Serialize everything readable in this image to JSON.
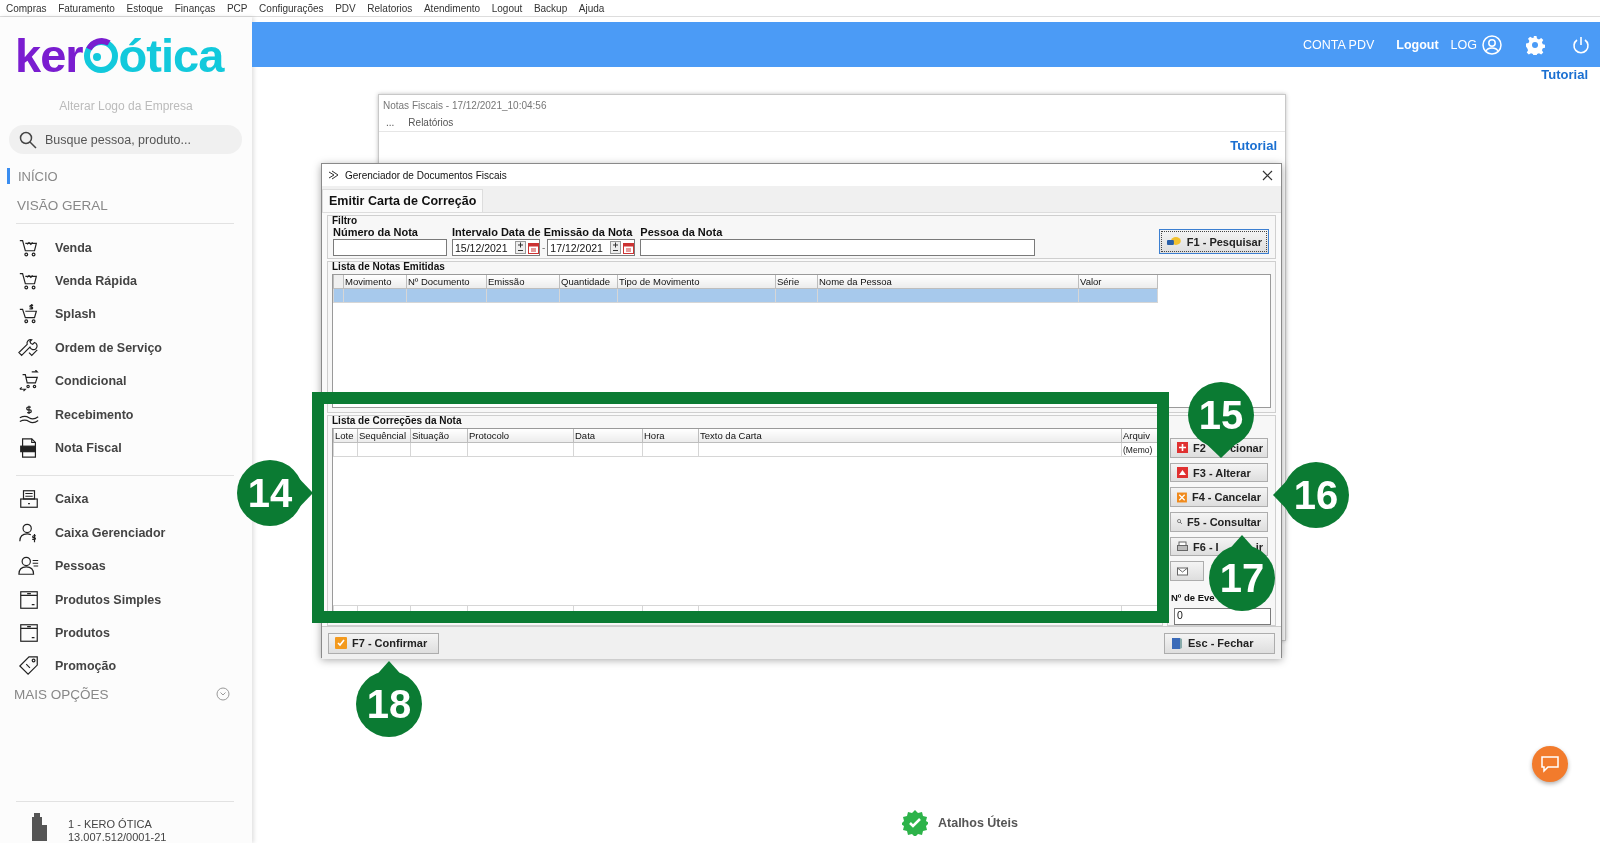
{
  "top_menu": [
    "Compras",
    "Faturamento",
    "Estoque",
    "Finanças",
    "PCP",
    "Configurações",
    "PDV",
    "Relatorios",
    "Atendimento",
    "Logout",
    "Backup",
    "Ajuda"
  ],
  "sidebar": {
    "logo": {
      "left": "ker",
      "right": "ótica"
    },
    "change_logo": "Alterar Logo da Empresa",
    "search": {
      "placeholder": "Busque pessoa, produto..."
    },
    "nav": [
      {
        "label": "INÍCIO",
        "selected": true
      },
      {
        "label": "VISÃO GERAL",
        "selected": false
      }
    ],
    "menu_groups": [
      [
        {
          "label": "Venda",
          "kind": "cart"
        },
        {
          "label": "Venda Rápida",
          "kind": "cart"
        },
        {
          "label": "Splash",
          "kind": "cart-dollar"
        },
        {
          "label": "Ordem de Serviço",
          "kind": "wrench"
        },
        {
          "label": "Condicional",
          "kind": "cart-arrows"
        },
        {
          "label": "Recebimento",
          "kind": "hand-coin"
        },
        {
          "label": "Nota Fiscal",
          "kind": "document"
        }
      ],
      [
        {
          "label": "Caixa",
          "kind": "register"
        },
        {
          "label": "Caixa Gerenciador",
          "kind": "person-dollar"
        },
        {
          "label": "Pessoas",
          "kind": "person-list"
        },
        {
          "label": "Produtos Simples",
          "kind": "box"
        },
        {
          "label": "Produtos",
          "kind": "box"
        },
        {
          "label": "Promoção",
          "kind": "tag"
        }
      ]
    ],
    "more": "MAIS OPÇÕES",
    "company": {
      "name": "1 - KERO ÓTICA",
      "tax_id": "13.007.512/0001-21"
    }
  },
  "header": {
    "account": "CONTA PDV",
    "logout": "Logout",
    "log": "LOG"
  },
  "tutorial": "Tutorial",
  "background_window": {
    "title": "Notas Fiscais - 17/12/2021_10:04:56",
    "menu": [
      "...",
      "Relatórios"
    ],
    "tutorial": "Tutorial"
  },
  "dialog": {
    "title": "Gerenciador de Documentos Fiscais",
    "tabs": [
      {
        "label": "Emitir Carta de Correção",
        "selected": true
      }
    ],
    "filter": {
      "legend": "Filtro",
      "number_label": "Número da Nota",
      "date_label": "Intervalo Data de Emissão da Nota",
      "date_from": "15/12/2021",
      "date_separator": "-",
      "date_to": "17/12/2021",
      "person_label": "Pessoa da Nota",
      "search_button": "F1 - Pesquisar"
    },
    "notes_table": {
      "title": "Lista de Notas Emitidas",
      "columns": [
        "Movimento",
        "Nº Documento",
        "Emissão",
        "Quantidade",
        "Tipo de Movimento",
        "Série",
        "Nome da Pessoa",
        "Valor"
      ],
      "rows": [
        {
          "selected": true
        }
      ]
    },
    "corrections_table": {
      "title": "Lista de Correções da Nota",
      "columns": [
        "Lote",
        "Sequêncial",
        "Situação",
        "Protocolo",
        "Data",
        "Hora",
        "Texto da Carta",
        "Arquiv"
      ],
      "rows": [
        {
          "selected": false,
          "last_cell": "(Memo)"
        }
      ]
    },
    "side_buttons": [
      {
        "kind": "add",
        "label": "F2",
        "label_end": "cionar"
      },
      {
        "kind": "edit",
        "label": "F3 - Alterar"
      },
      {
        "kind": "cancel",
        "label": "F4 - Cancelar"
      },
      {
        "kind": "search",
        "label": "F5 - Consultar"
      },
      {
        "kind": "print",
        "label": "F6 - I",
        "label_end": "ir"
      },
      {
        "kind": "email"
      }
    ],
    "event_label": "Nº de Eve",
    "event_value": "0",
    "confirm_button": "F7 - Confirmar",
    "close_button": "Esc - Fechar"
  },
  "callouts": [
    {
      "number": "14",
      "kind": "right"
    },
    {
      "number": "15",
      "kind": "down"
    },
    {
      "number": "16",
      "kind": "left"
    },
    {
      "number": "17",
      "kind": "up"
    },
    {
      "number": "18",
      "kind": "up"
    }
  ],
  "shortcuts": "Atalhos Úteis"
}
